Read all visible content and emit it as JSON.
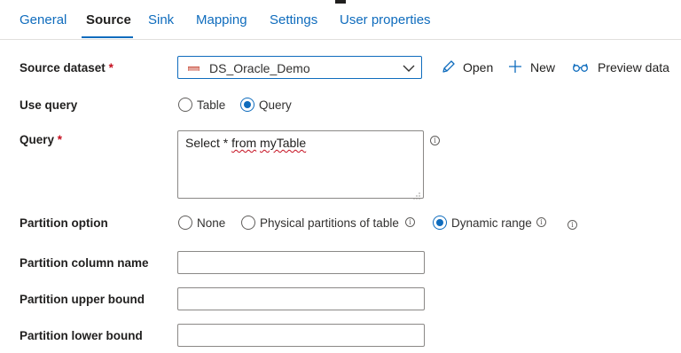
{
  "tabs": [
    {
      "label": "General"
    },
    {
      "label": "Source"
    },
    {
      "label": "Sink"
    },
    {
      "label": "Mapping"
    },
    {
      "label": "Settings"
    },
    {
      "label": "User properties"
    }
  ],
  "active_tab": "Source",
  "accent_color": "#0f6cbd",
  "required_color": "#c50f1f",
  "source_dataset": {
    "label": "Source dataset",
    "required_mark": "*",
    "value": "DS_Oracle_Demo",
    "icon": "oracle-dataset-icon",
    "actions": {
      "open": "Open",
      "new": "New",
      "preview": "Preview data"
    }
  },
  "use_query": {
    "label": "Use query",
    "options": [
      "Table",
      "Query"
    ],
    "selected": "Query"
  },
  "query": {
    "label": "Query",
    "required_mark": "*",
    "value_prefix": "Select * ",
    "value_misspelled_1": "from",
    "value_space": " ",
    "value_misspelled_2": "myTable",
    "info_icon": "info-icon"
  },
  "partition_option": {
    "label": "Partition option",
    "options": [
      "None",
      "Physical partitions of table",
      "Dynamic range"
    ],
    "selected": "Dynamic range"
  },
  "partition_column_name": {
    "label": "Partition column name",
    "value": ""
  },
  "partition_upper_bound": {
    "label": "Partition upper bound",
    "value": ""
  },
  "partition_lower_bound": {
    "label": "Partition lower bound",
    "value": ""
  }
}
